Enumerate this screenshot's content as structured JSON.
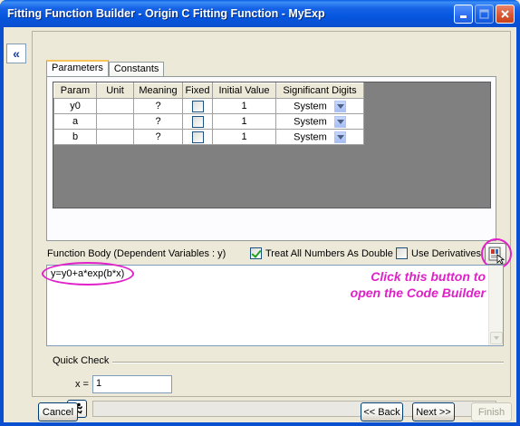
{
  "window": {
    "title": "Fitting Function Builder - Origin C Fitting Function - MyExp",
    "controls": [
      "minimize-icon",
      "maximize-icon",
      "close-icon"
    ]
  },
  "sidebar": {
    "collapse_label": "«"
  },
  "tabs": [
    {
      "label": "Parameters",
      "active": true
    },
    {
      "label": "Constants",
      "active": false
    }
  ],
  "params_table": {
    "columns": [
      "Param",
      "Unit",
      "Meaning",
      "Fixed",
      "Initial Value",
      "Significant Digits"
    ],
    "rows": [
      {
        "param": "y0",
        "unit": "",
        "meaning": "?",
        "fixed": false,
        "initial": "1",
        "digits": "System"
      },
      {
        "param": "a",
        "unit": "",
        "meaning": "?",
        "fixed": false,
        "initial": "1",
        "digits": "System"
      },
      {
        "param": "b",
        "unit": "",
        "meaning": "?",
        "fixed": false,
        "initial": "1",
        "digits": "System"
      }
    ]
  },
  "function_body": {
    "label": "Function Body (Dependent Variables : y)",
    "treat_all_numbers_label": "Treat All Numbers As Double",
    "treat_all_numbers_checked": true,
    "use_derivatives_label": "Use Derivatives",
    "use_derivatives_checked": false,
    "code": "y=y0+a*exp(b*x)"
  },
  "annotation": {
    "line1": "Click this button to",
    "line2": "open the Code Builder",
    "color": "#e020c8"
  },
  "quick_check": {
    "label": "Quick Check",
    "x_label": "x =",
    "x_value": "1",
    "result": ""
  },
  "footer": {
    "cancel": "Cancel",
    "back": "<< Back",
    "next": "Next >>",
    "finish": "Finish"
  }
}
